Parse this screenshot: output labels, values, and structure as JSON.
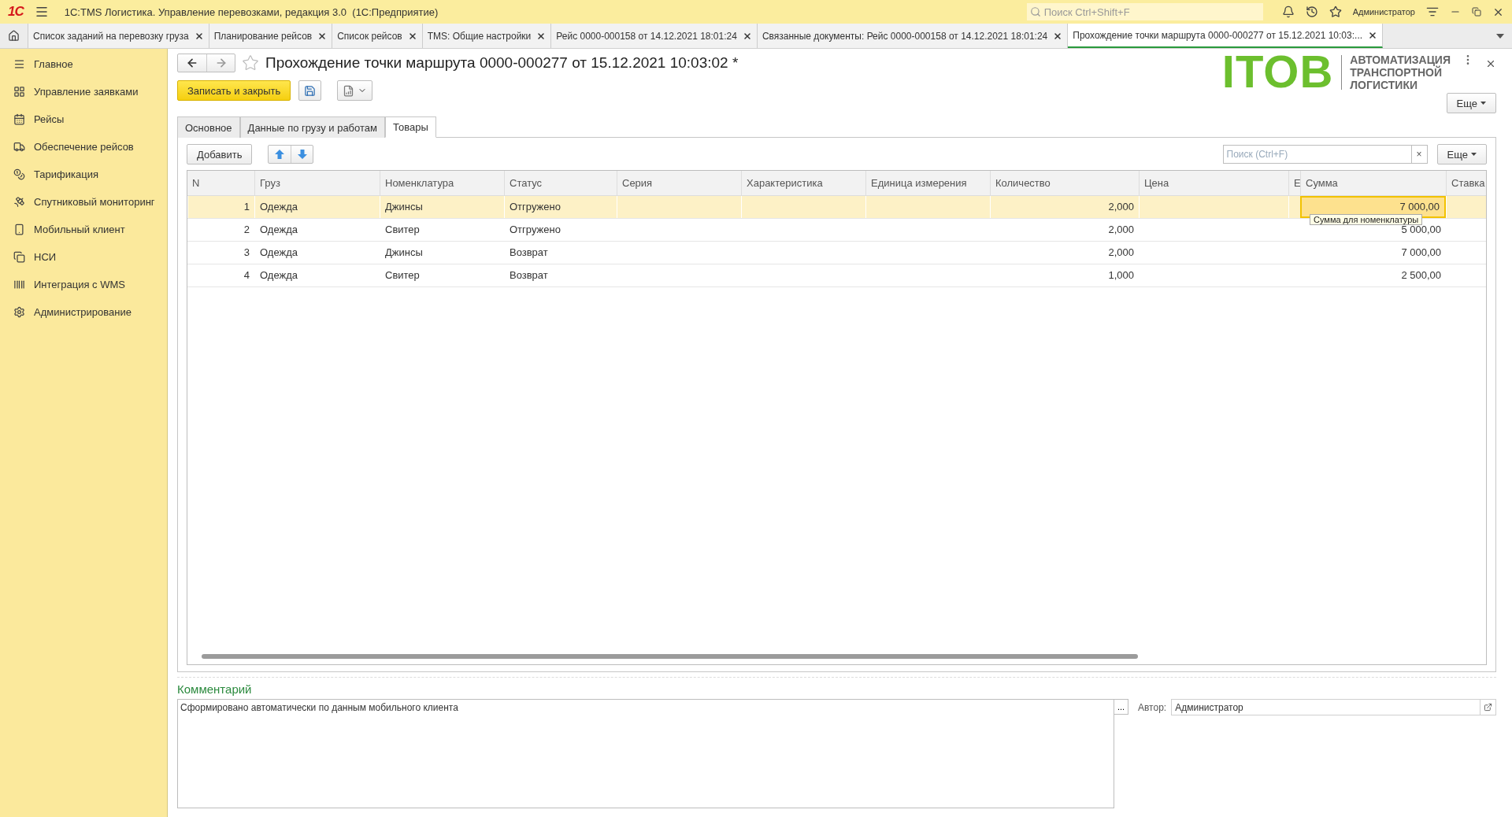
{
  "app": {
    "logo": "1С",
    "title": "1С:TMS Логистика. Управление перевозками, редакция 3.0  (1С:Предприятие)",
    "search_placeholder": "Поиск Ctrl+Shift+F",
    "user": "Администратор"
  },
  "open_tabs": [
    {
      "label": "Список заданий на перевозку груза",
      "selected": false
    },
    {
      "label": "Планирование рейсов",
      "selected": false
    },
    {
      "label": "Список рейсов",
      "selected": false
    },
    {
      "label": "TMS: Общие настройки",
      "selected": false
    },
    {
      "label": "Рейс 0000-000158 от 14.12.2021 18:01:24",
      "selected": false
    },
    {
      "label": "Связанные документы: Рейс 0000-000158 от 14.12.2021 18:01:24",
      "selected": false
    },
    {
      "label": "Прохождение точки маршрута 0000-000277 от 15.12.2021 10:03:...",
      "selected": true
    }
  ],
  "sidebar": {
    "items": [
      {
        "label": "Главное"
      },
      {
        "label": "Управление заявками"
      },
      {
        "label": "Рейсы"
      },
      {
        "label": "Обеспечение рейсов"
      },
      {
        "label": "Тарификация"
      },
      {
        "label": "Спутниковый мониторинг"
      },
      {
        "label": "Мобильный клиент"
      },
      {
        "label": "НСИ"
      },
      {
        "label": "Интеграция с WMS"
      },
      {
        "label": "Администрирование"
      }
    ]
  },
  "form": {
    "title": "Прохождение точки маршрута 0000-000277 от 15.12.2021 10:03:02 *",
    "save_close": "Записать и закрыть",
    "more": "Еще"
  },
  "brand": {
    "mark": "ITOB",
    "lines": [
      "АВТОМАТИЗАЦИЯ",
      "ТРАНСПОРТНОЙ",
      "ЛОГИСТИКИ"
    ]
  },
  "form_tabs": [
    {
      "label": "Основное",
      "selected": false
    },
    {
      "label": "Данные по грузу и работам",
      "selected": false
    },
    {
      "label": "Товары",
      "selected": true
    }
  ],
  "table_toolbar": {
    "add": "Добавить",
    "search_placeholder": "Поиск (Ctrl+F)",
    "clear": "×",
    "more": "Еще"
  },
  "table": {
    "columns": [
      "N",
      "Груз",
      "Номенклатура",
      "Статус",
      "Серия",
      "Характеристика",
      "Единица измерения",
      "Количество",
      "Цена",
      "Е",
      "Сумма",
      "Ставка"
    ],
    "rows": [
      {
        "selected": true,
        "cells": [
          "1",
          "Одежда",
          "Джинсы",
          "Отгружено",
          null,
          null,
          null,
          "2,000",
          null,
          null,
          "7 000,00",
          null
        ]
      },
      {
        "selected": false,
        "cells": [
          "2",
          "Одежда",
          "Свитер",
          "Отгружено",
          null,
          null,
          null,
          "2,000",
          null,
          null,
          "5 000,00",
          null
        ]
      },
      {
        "selected": false,
        "cells": [
          "3",
          "Одежда",
          "Джинсы",
          "Возврат",
          null,
          null,
          null,
          "2,000",
          null,
          null,
          "7 000,00",
          null
        ]
      },
      {
        "selected": false,
        "cells": [
          "4",
          "Одежда",
          "Свитер",
          "Возврат",
          null,
          null,
          null,
          "1,000",
          null,
          null,
          "2 500,00",
          null
        ]
      }
    ],
    "tooltip": "Сумма для номенклатуры"
  },
  "comment": {
    "label": "Комментарий",
    "value": "Сформировано автоматически по данным мобильного клиента",
    "select": "..."
  },
  "author": {
    "label": "Автор:",
    "value": "Администратор"
  }
}
